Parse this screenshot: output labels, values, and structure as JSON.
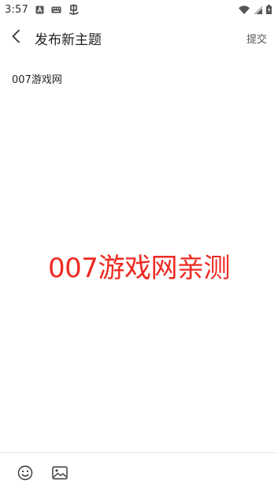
{
  "status_bar": {
    "time": "3:57",
    "icons_left": [
      "a-box-icon",
      "keyboard-icon",
      "app-notification-icon"
    ],
    "icons_right": [
      "wifi-icon",
      "cell-signal-icon",
      "battery-charging-icon"
    ]
  },
  "toolbar": {
    "title": "发布新主题",
    "submit_label": "提交",
    "back_icon": "chevron-left-icon"
  },
  "editor": {
    "title_text": "007游戏网",
    "watermark_text": "007游戏网亲测",
    "watermark_color": "#ee2a22"
  },
  "bottom_bar": {
    "icons": [
      "emoji-icon",
      "image-icon"
    ]
  },
  "colors": {
    "background": "#ffffff",
    "text": "#222222",
    "muted": "#555555"
  }
}
